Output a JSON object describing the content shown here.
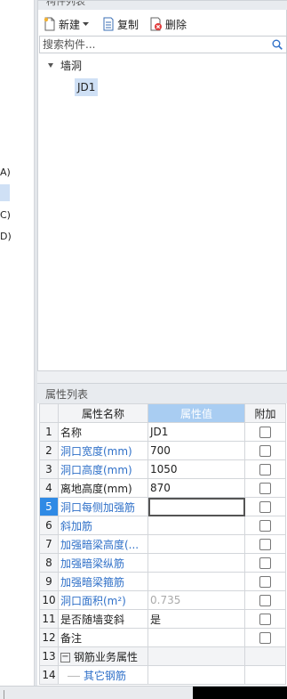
{
  "left_panel": {
    "fragments": [
      "A)",
      "C)",
      "D)"
    ]
  },
  "component_list": {
    "title": "构件列表",
    "toolbar": {
      "new_label": "新建",
      "copy_label": "复制",
      "delete_label": "删除"
    },
    "search_placeholder": "搜索构件...",
    "tree": {
      "root": "墙洞",
      "child": "JD1"
    }
  },
  "property_list": {
    "title": "属性列表",
    "columns": [
      "属性名称",
      "属性值",
      "附加"
    ],
    "rows": [
      {
        "num": "1",
        "name": "名称",
        "value": "JD1"
      },
      {
        "num": "2",
        "name": "洞口宽度(mm)",
        "value": "700"
      },
      {
        "num": "3",
        "name": "洞口高度(mm)",
        "value": "1050"
      },
      {
        "num": "4",
        "name": "离地高度(mm)",
        "value": "870"
      },
      {
        "num": "5",
        "name": "洞口每侧加强筋",
        "value": ""
      },
      {
        "num": "6",
        "name": "斜加筋",
        "value": ""
      },
      {
        "num": "7",
        "name": "加强暗梁高度(...",
        "value": ""
      },
      {
        "num": "8",
        "name": "加强暗梁纵筋",
        "value": ""
      },
      {
        "num": "9",
        "name": "加强暗梁箍筋",
        "value": ""
      },
      {
        "num": "10",
        "name": "洞口面积(m²)",
        "value": "0.735"
      },
      {
        "num": "11",
        "name": "是否随墙变斜",
        "value": "是"
      },
      {
        "num": "12",
        "name": "备注",
        "value": ""
      },
      {
        "num": "13",
        "name": "钢筋业务属性",
        "expand": "−"
      },
      {
        "num": "14",
        "name": "其它钢筋",
        "value": ""
      }
    ]
  },
  "colors": {
    "selected_bg": "#cfe0f5",
    "header_blue": "#a9cdf2",
    "row_selected": "#2f8ae5",
    "link_blue": "#2f70c8"
  },
  "icons": {
    "new": "new-document-icon",
    "copy": "copy-icon",
    "delete": "delete-icon",
    "search": "search-icon",
    "tree": "collapse-arrow-icon"
  }
}
